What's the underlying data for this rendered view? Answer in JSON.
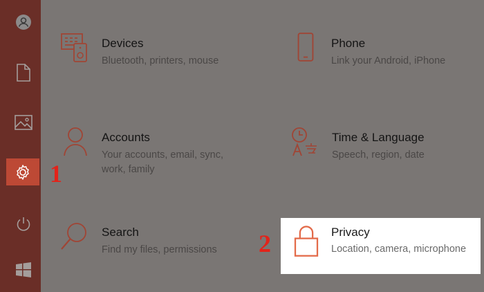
{
  "accent_color": "#bd4935",
  "sidebar": {
    "items": [
      {
        "name": "account",
        "icon": "person-icon"
      },
      {
        "name": "documents",
        "icon": "document-icon"
      },
      {
        "name": "pictures",
        "icon": "picture-icon"
      },
      {
        "name": "settings",
        "icon": "gear-icon",
        "active": true
      },
      {
        "name": "power",
        "icon": "power-icon"
      },
      {
        "name": "start",
        "icon": "windows-logo-icon"
      }
    ]
  },
  "tiles": [
    {
      "title": "Devices",
      "description": "Bluetooth, printers, mouse",
      "icon": "devices-icon"
    },
    {
      "title": "Phone",
      "description": "Link your Android, iPhone",
      "icon": "phone-icon"
    },
    {
      "title": "Accounts",
      "description_lines": [
        "Your accounts, email, sync,",
        "work, family"
      ],
      "icon": "person-icon"
    },
    {
      "title": "Time & Language",
      "description": "Speech, region, date",
      "icon": "time-language-icon"
    },
    {
      "title": "Search",
      "description": "Find my files, permissions",
      "icon": "search-icon"
    },
    {
      "title": "Privacy",
      "description": "Location, camera, microphone",
      "icon": "lock-icon",
      "highlighted": true
    }
  ],
  "annotations": {
    "step1": "1",
    "step2": "2"
  }
}
